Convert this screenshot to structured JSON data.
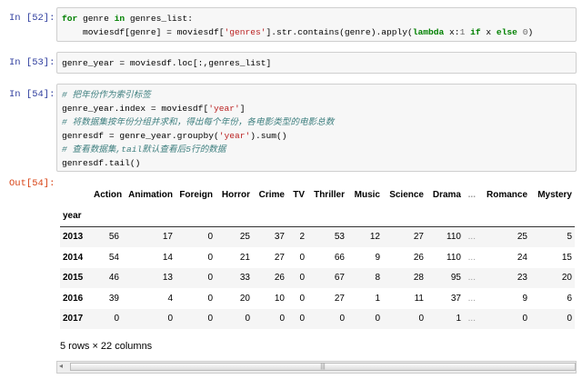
{
  "cells": [
    {
      "prompt": "In [52]:"
    },
    {
      "prompt": "In [53]:"
    },
    {
      "prompt": "In [54]:"
    }
  ],
  "code": {
    "c52_l1_kw1": "for",
    "c52_l1_a": " genre ",
    "c52_l1_kw2": "in",
    "c52_l1_b": " genres_list:",
    "c52_l2_a": "    moviesdf[genre] = moviesdf[",
    "c52_l2_str": "'genres'",
    "c52_l2_b": "].str.contains(genre).apply(",
    "c52_l2_kw1": "lambda",
    "c52_l2_c": " x:",
    "c52_l2_n1": "1",
    "c52_l2_d": " ",
    "c52_l2_kw2": "if",
    "c52_l2_e": " x ",
    "c52_l2_kw3": "else",
    "c52_l2_f": " ",
    "c52_l2_n2": "0",
    "c52_l2_g": ")",
    "c53": "genre_year = moviesdf.loc[:,genres_list]",
    "c54_cm1": "# 把年份作为索引标签",
    "c54_l2_a": "genre_year.index = moviesdf[",
    "c54_l2_str": "'year'",
    "c54_l2_b": "]",
    "c54_cm2": "# 将数据集按年份分组并求和，得出每个年份，各电影类型的电影总数",
    "c54_l4_a": "genresdf = genre_year.groupby(",
    "c54_l4_str": "'year'",
    "c54_l4_b": ").sum()",
    "c54_cm3": "# 查看数据集,tail默认查看后5行的数据",
    "c54_l6": "genresdf.tail()"
  },
  "output": {
    "prompt": "Out[54]:",
    "index_name": "year",
    "columns": [
      "Action",
      "Animation",
      "Foreign",
      "Horror",
      "Crime",
      "TV",
      "Thriller",
      "Music",
      "Science",
      "Drama",
      "...",
      "Romance",
      "Mystery"
    ],
    "rows": [
      {
        "year": "2013",
        "values": [
          "56",
          "17",
          "0",
          "25",
          "37",
          "2",
          "53",
          "12",
          "27",
          "110",
          "...",
          "25",
          "5"
        ]
      },
      {
        "year": "2014",
        "values": [
          "54",
          "14",
          "0",
          "21",
          "27",
          "0",
          "66",
          "9",
          "26",
          "110",
          "...",
          "24",
          "15"
        ]
      },
      {
        "year": "2015",
        "values": [
          "46",
          "13",
          "0",
          "33",
          "26",
          "0",
          "67",
          "8",
          "28",
          "95",
          "...",
          "23",
          "20"
        ]
      },
      {
        "year": "2016",
        "values": [
          "39",
          "4",
          "0",
          "20",
          "10",
          "0",
          "27",
          "1",
          "11",
          "37",
          "...",
          "9",
          "6"
        ]
      },
      {
        "year": "2017",
        "values": [
          "0",
          "0",
          "0",
          "0",
          "0",
          "0",
          "0",
          "0",
          "0",
          "1",
          "...",
          "0",
          "0"
        ]
      }
    ],
    "shape": "5 rows × 22 columns"
  },
  "scrollbar": {
    "grip": "|||",
    "left_arrow": "◂"
  }
}
